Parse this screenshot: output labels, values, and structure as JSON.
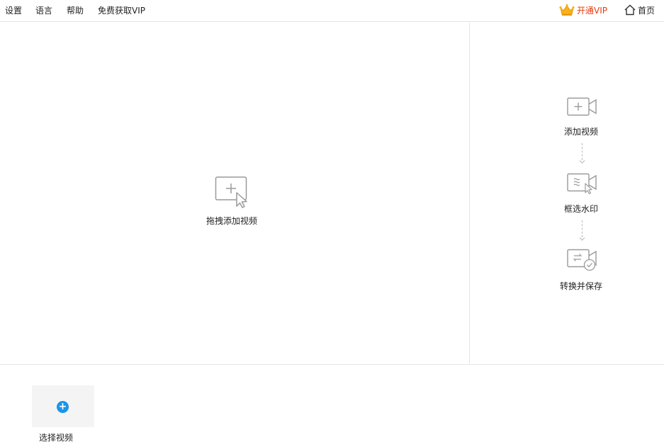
{
  "menu": {
    "items": [
      "设置",
      "语言",
      "帮助",
      "免费获取VIP"
    ],
    "vip_label": "开通VIP",
    "home_label": "首页"
  },
  "drop_area": {
    "label": "拖拽添加视频"
  },
  "steps": [
    {
      "label": "添加视频",
      "icon": "video-add-icon"
    },
    {
      "label": "框选水印",
      "icon": "video-select-watermark-icon"
    },
    {
      "label": "转换并保存",
      "icon": "video-convert-save-icon"
    }
  ],
  "bottom": {
    "select_label": "选择视频"
  },
  "colors": {
    "vip_red": "#e8380d",
    "accent_blue": "#1a95e8",
    "icon_gray": "#9a9a9a"
  }
}
